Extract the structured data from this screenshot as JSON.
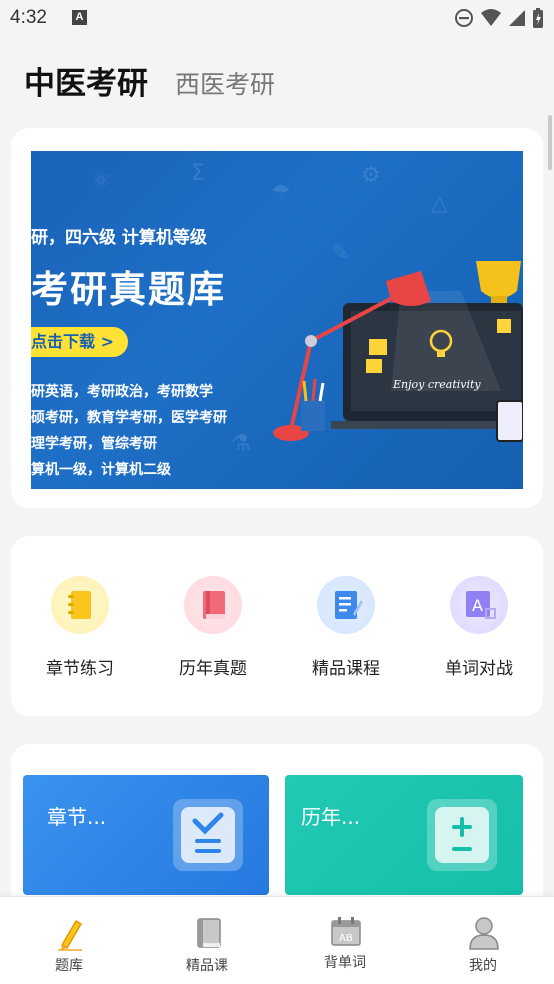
{
  "status_bar": {
    "time": "4:32",
    "notification_badge": "A"
  },
  "header": {
    "title_active": "中医考研",
    "title_inactive": "西医考研"
  },
  "banner": {
    "line1": "研，四六级  计算机等级",
    "line2": "考研真题库",
    "cta": "点击下载 >",
    "line3": "研英语，考研政治，考研数学",
    "line4": "硕考研，教育学考研，医学考研",
    "line5": "理学考研，管综考研",
    "line6": "算机一级，计算机二级",
    "monitor_text": "Enjoy creativity",
    "colors": {
      "background": "#1a63b8",
      "cta": "#ffe233"
    }
  },
  "menu": [
    {
      "label": "章节练习",
      "icon": "notebook-icon",
      "color": "#f7c51e"
    },
    {
      "label": "历年真题",
      "icon": "book-icon",
      "color": "#f06a7a"
    },
    {
      "label": "精品课程",
      "icon": "document-edit-icon",
      "color": "#3f88ec"
    },
    {
      "label": "单词对战",
      "icon": "letter-a-card-icon",
      "color": "#7d6cf0"
    }
  ],
  "tiles": [
    {
      "label": "章节...",
      "icon": "checklist-icon",
      "color": "#2f86e8"
    },
    {
      "label": "历年...",
      "icon": "plus-minus-icon",
      "color": "#1ec7b3"
    }
  ],
  "tabbar": [
    {
      "label": "题库",
      "icon": "pencil-icon",
      "active": true
    },
    {
      "label": "精品课",
      "icon": "books-icon",
      "active": false
    },
    {
      "label": "背单词",
      "icon": "calendar-ab-icon",
      "active": false
    },
    {
      "label": "我的",
      "icon": "user-icon",
      "active": false
    }
  ]
}
